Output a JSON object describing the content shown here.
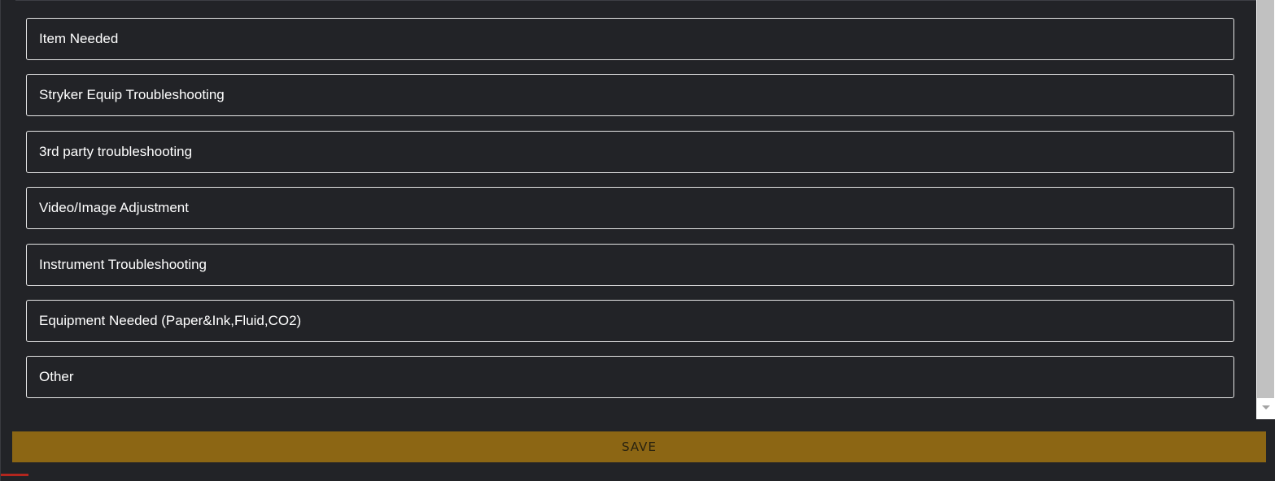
{
  "options": [
    {
      "label": "Item Needed"
    },
    {
      "label": "Stryker Equip Troubleshooting"
    },
    {
      "label": "3rd party troubleshooting"
    },
    {
      "label": "Video/Image Adjustment"
    },
    {
      "label": "Instrument Troubleshooting"
    },
    {
      "label": "Equipment Needed (Paper&Ink,Fluid,CO2)"
    },
    {
      "label": "Other"
    }
  ],
  "save": {
    "label": "SAVE"
  },
  "colors": {
    "background": "#222327",
    "option_border": "#e6e6e6",
    "save_button": "#8c6614"
  }
}
